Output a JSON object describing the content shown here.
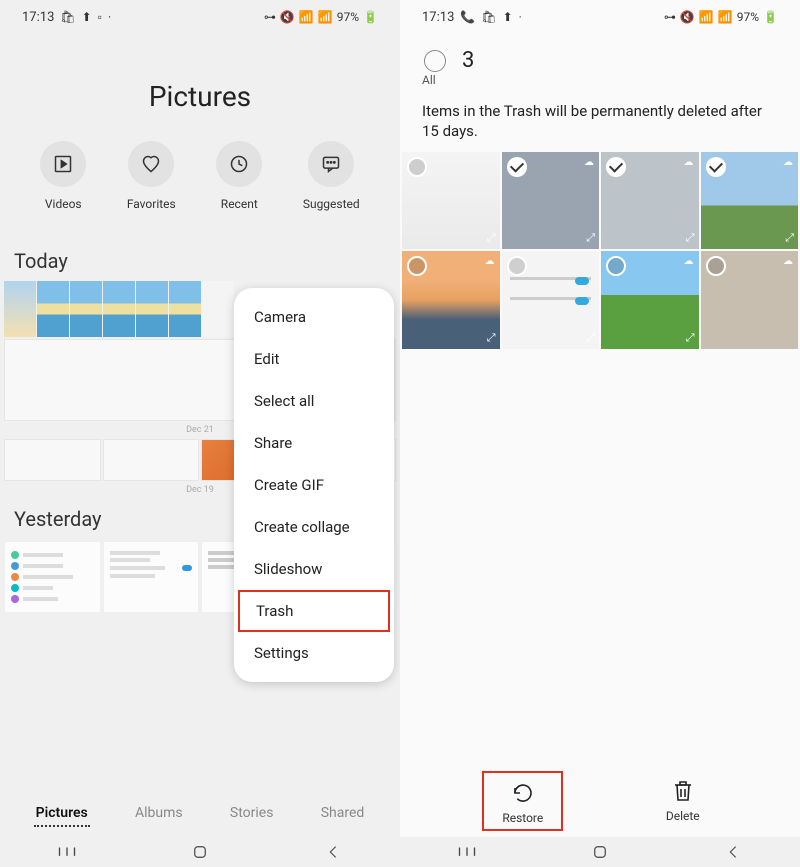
{
  "status": {
    "time": "17:13",
    "battery": "97%"
  },
  "left": {
    "title": "Pictures",
    "categories": [
      {
        "label": "Videos"
      },
      {
        "label": "Favorites"
      },
      {
        "label": "Recent"
      },
      {
        "label": "Suggested"
      }
    ],
    "sections": {
      "today": "Today",
      "yesterday": "Yesterday"
    },
    "menu": [
      "Camera",
      "Edit",
      "Select all",
      "Share",
      "Create GIF",
      "Create collage",
      "Slideshow",
      "Trash",
      "Settings"
    ],
    "tabs": {
      "pictures": "Pictures",
      "albums": "Albums",
      "stories": "Stories",
      "shared": "Shared"
    },
    "dates": {
      "dec21": "Dec 21",
      "dec19": "Dec 19"
    }
  },
  "right": {
    "count": "3",
    "allLabel": "All",
    "notice": "Items in the Trash will be permanently deleted after 15 days.",
    "actions": {
      "restore": "Restore",
      "delete": "Delete"
    }
  }
}
